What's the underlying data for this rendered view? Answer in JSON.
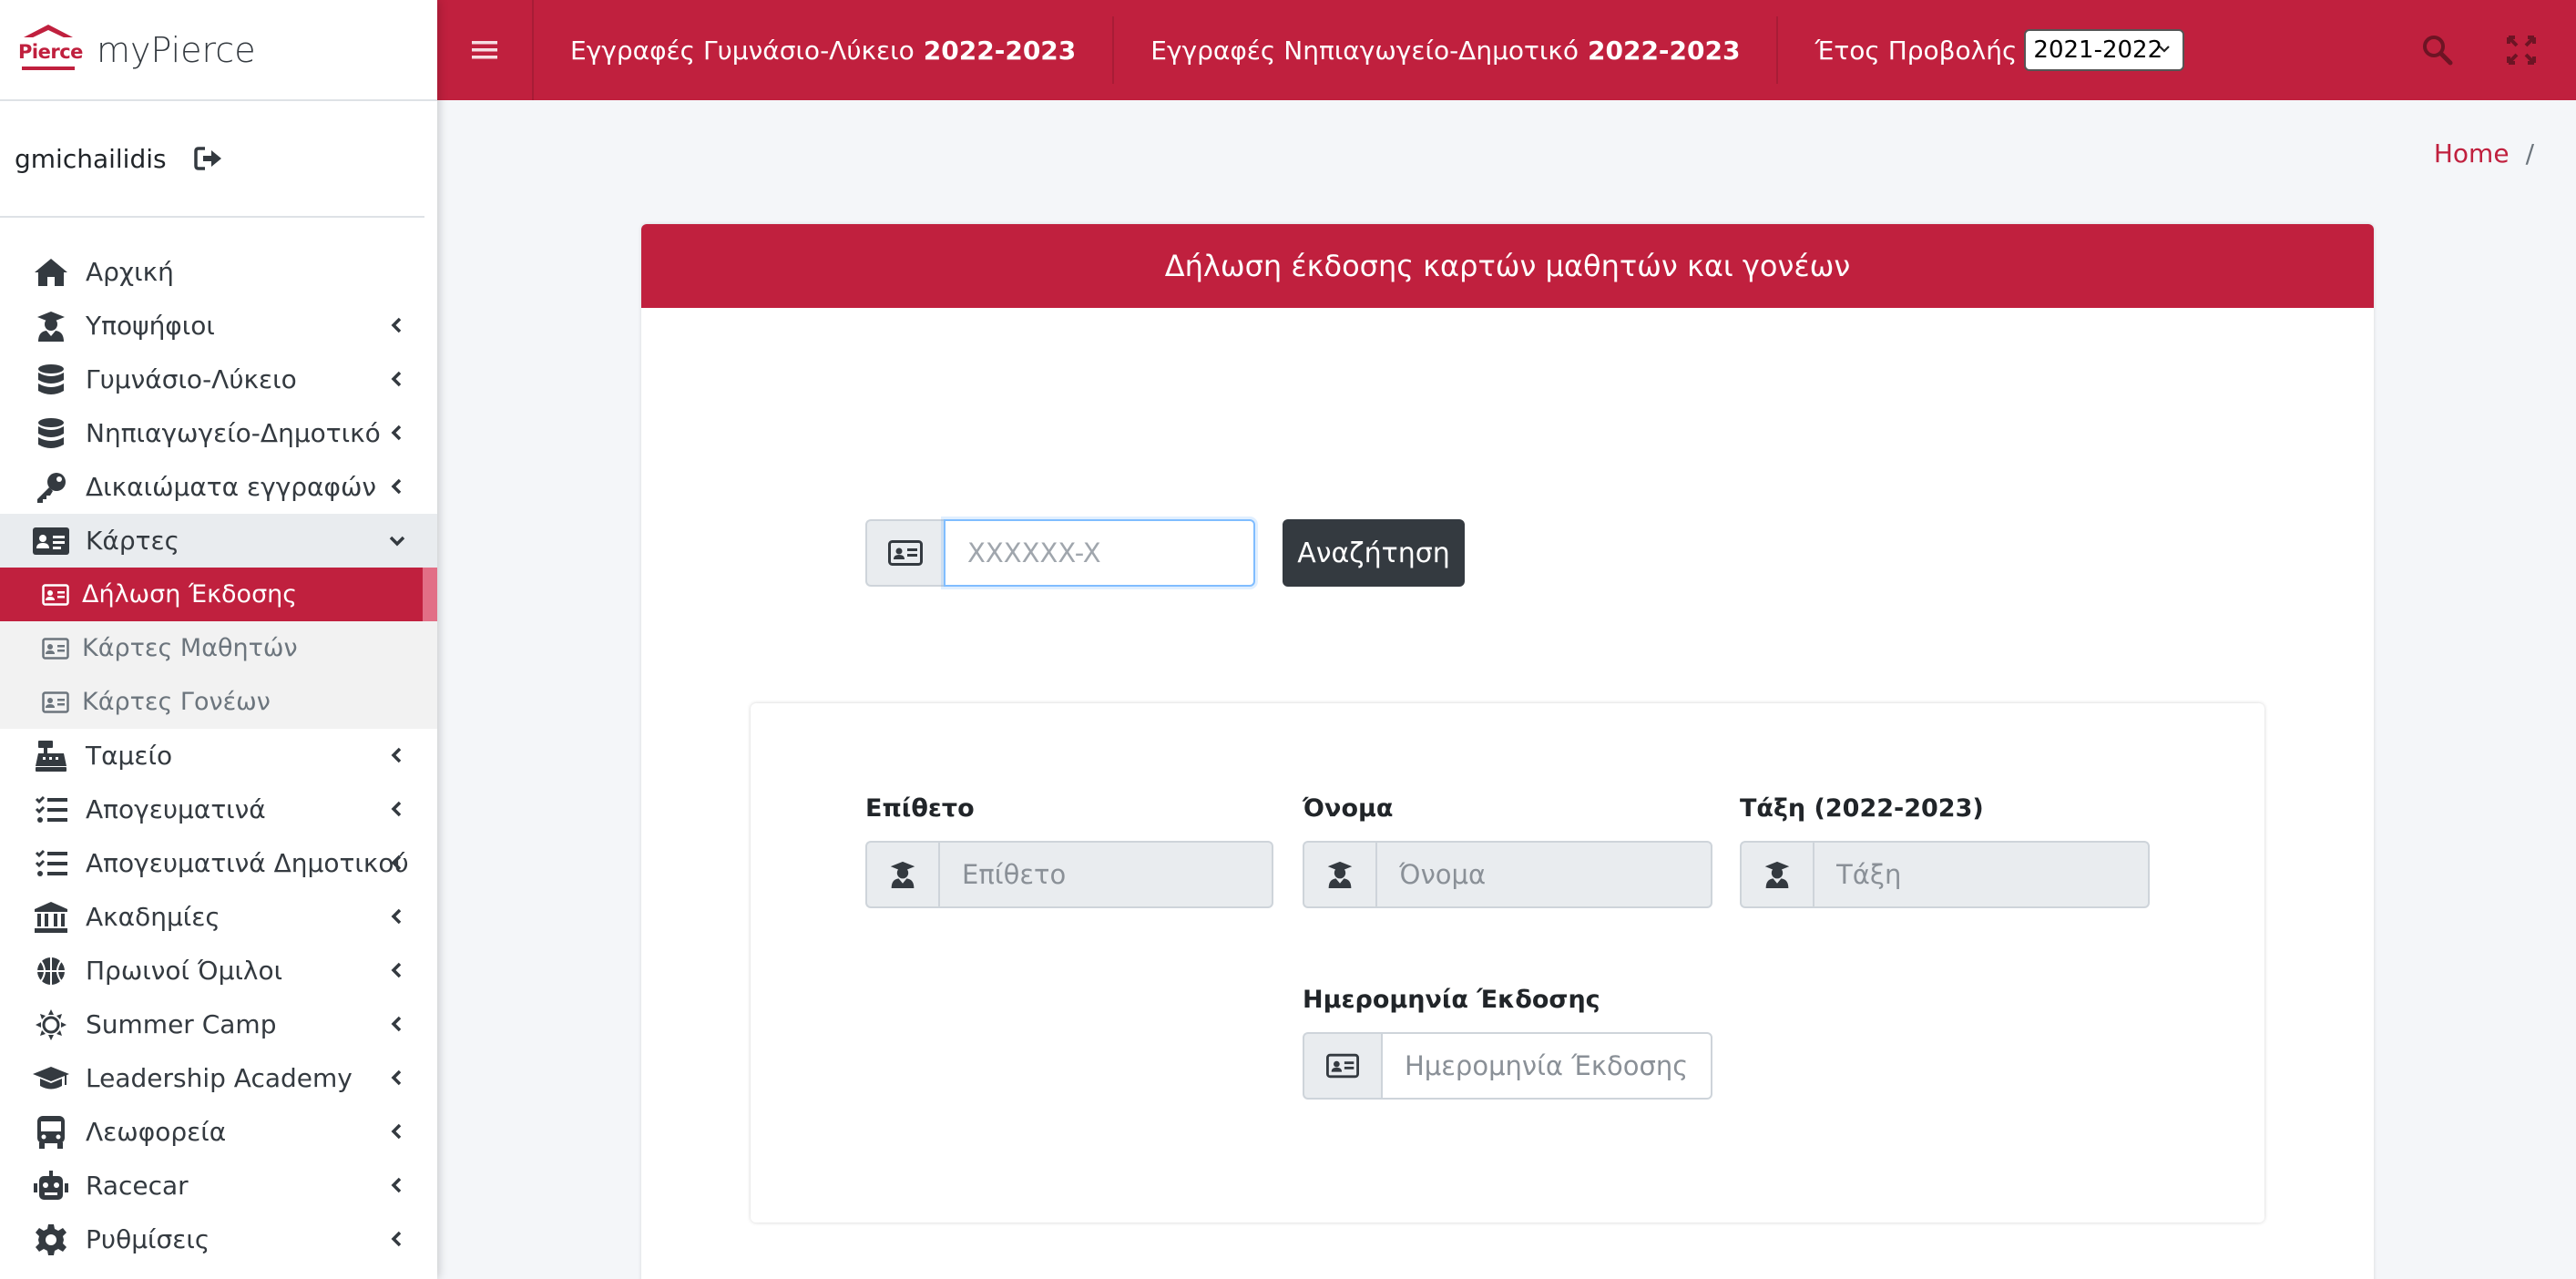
{
  "brand": {
    "logo_text": "Pierce",
    "title": "myPierce"
  },
  "user": {
    "username": "gmichailidis"
  },
  "sidebar": {
    "items": [
      {
        "label": "Αρχική",
        "icon": "home-icon"
      },
      {
        "label": "Υποψήφιοι",
        "icon": "user-graduate-icon"
      },
      {
        "label": "Γυμνάσιο-Λύκειο",
        "icon": "database-icon"
      },
      {
        "label": "Νηπιαγωγείο-Δημοτικό",
        "icon": "database-icon"
      },
      {
        "label": "Δικαιώματα εγγραφών",
        "icon": "key-icon"
      },
      {
        "label": "Κάρτες",
        "icon": "id-card-icon"
      },
      {
        "label": "Δήλωση Έκδοσης",
        "icon": "id-card-icon"
      },
      {
        "label": "Κάρτες Μαθητών",
        "icon": "id-card-icon"
      },
      {
        "label": "Κάρτες Γονέων",
        "icon": "id-card-icon"
      },
      {
        "label": "Ταμείο",
        "icon": "cash-register-icon"
      },
      {
        "label": "Απογευματινά",
        "icon": "tasks-icon"
      },
      {
        "label": "Απογευματινά Δημοτικού",
        "icon": "tasks-icon"
      },
      {
        "label": "Ακαδημίες",
        "icon": "university-icon"
      },
      {
        "label": "Πρωινοί Όμιλοι",
        "icon": "basketball-icon"
      },
      {
        "label": "Summer Camp",
        "icon": "sun-icon"
      },
      {
        "label": "Leadership Academy",
        "icon": "graduation-cap-icon"
      },
      {
        "label": "Λεωφορεία",
        "icon": "bus-icon"
      },
      {
        "label": "Racecar",
        "icon": "robot-icon"
      },
      {
        "label": "Ρυθμίσεις",
        "icon": "gear-icon"
      }
    ]
  },
  "topbar": {
    "link1_text": "Εγγραφές Γυμνάσιο-Λύκειο",
    "link1_year": "2022-2023",
    "link2_text": "Εγγραφές Νηπιαγωγείο-Δημοτικό",
    "link2_year": "2022-2023",
    "year_label": "Έτος Προβολής",
    "year_value": "2021-2022"
  },
  "breadcrumb": {
    "home": "Home",
    "separator": "/"
  },
  "card": {
    "title": "Δήλωση έκδοσης καρτών μαθητών και γονέων",
    "search_placeholder": "XXXXXX-X",
    "search_button": "Αναζήτηση"
  },
  "form": {
    "surname_label": "Επίθετο",
    "surname_placeholder": "Επίθετο",
    "name_label": "Όνομα",
    "name_placeholder": "Όνομα",
    "class_label": "Τάξη (2022-2023)",
    "class_placeholder": "Τάξη",
    "issue_date_label": "Ημερομηνία Έκδοσης",
    "issue_date_placeholder": "Ημερομηνία Έκδοσης"
  },
  "colors": {
    "brand": "#c0203e",
    "dark_button": "#343a40"
  }
}
